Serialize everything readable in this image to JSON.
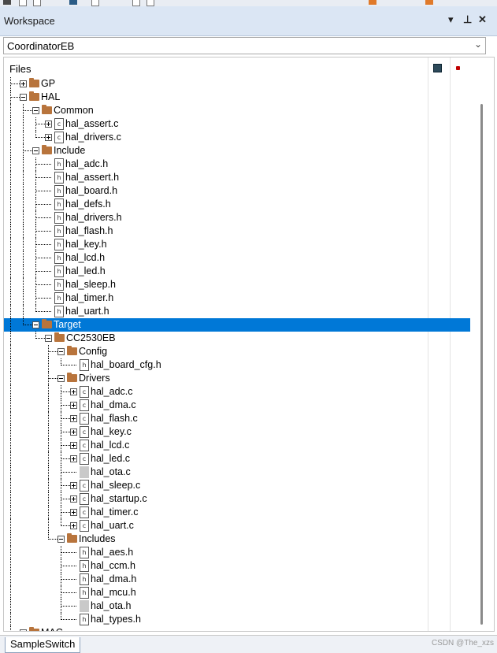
{
  "window": {
    "title": "Workspace",
    "buttons": [
      {
        "name": "dropdown-menu-button",
        "glyph": "▾"
      },
      {
        "name": "pin-button",
        "glyph": "⊥"
      },
      {
        "name": "close-button",
        "glyph": "✕"
      }
    ]
  },
  "configuration": {
    "selected": "CoordinatorEB"
  },
  "tree": {
    "header": "Files",
    "nodes": [
      {
        "label": "GP",
        "kind": "folder",
        "depth": 0,
        "exp": "plus",
        "last": false
      },
      {
        "label": "HAL",
        "kind": "folder",
        "depth": 0,
        "exp": "minus",
        "last": false
      },
      {
        "label": "Common",
        "kind": "folder",
        "depth": 1,
        "exp": "minus",
        "last": false
      },
      {
        "label": "hal_assert.c",
        "kind": "c",
        "depth": 2,
        "exp": "plus",
        "last": false
      },
      {
        "label": "hal_drivers.c",
        "kind": "c",
        "depth": 2,
        "exp": "plus",
        "last": true
      },
      {
        "label": "Include",
        "kind": "folder",
        "depth": 1,
        "exp": "minus",
        "last": false
      },
      {
        "label": "hal_adc.h",
        "kind": "h",
        "depth": 2,
        "exp": null,
        "last": false
      },
      {
        "label": "hal_assert.h",
        "kind": "h",
        "depth": 2,
        "exp": null,
        "last": false
      },
      {
        "label": "hal_board.h",
        "kind": "h",
        "depth": 2,
        "exp": null,
        "last": false
      },
      {
        "label": "hal_defs.h",
        "kind": "h",
        "depth": 2,
        "exp": null,
        "last": false
      },
      {
        "label": "hal_drivers.h",
        "kind": "h",
        "depth": 2,
        "exp": null,
        "last": false
      },
      {
        "label": "hal_flash.h",
        "kind": "h",
        "depth": 2,
        "exp": null,
        "last": false
      },
      {
        "label": "hal_key.h",
        "kind": "h",
        "depth": 2,
        "exp": null,
        "last": false
      },
      {
        "label": "hal_lcd.h",
        "kind": "h",
        "depth": 2,
        "exp": null,
        "last": false
      },
      {
        "label": "hal_led.h",
        "kind": "h",
        "depth": 2,
        "exp": null,
        "last": false
      },
      {
        "label": "hal_sleep.h",
        "kind": "h",
        "depth": 2,
        "exp": null,
        "last": false
      },
      {
        "label": "hal_timer.h",
        "kind": "h",
        "depth": 2,
        "exp": null,
        "last": false
      },
      {
        "label": "hal_uart.h",
        "kind": "h",
        "depth": 2,
        "exp": null,
        "last": true
      },
      {
        "label": "Target",
        "kind": "folder",
        "depth": 1,
        "exp": "minus",
        "last": true,
        "selected": true
      },
      {
        "label": "CC2530EB",
        "kind": "folder",
        "depth": 2,
        "exp": "minus",
        "last": true
      },
      {
        "label": "Config",
        "kind": "folder",
        "depth": 3,
        "exp": "minus",
        "last": false
      },
      {
        "label": "hal_board_cfg.h",
        "kind": "h",
        "depth": 4,
        "exp": null,
        "last": true
      },
      {
        "label": "Drivers",
        "kind": "folder",
        "depth": 3,
        "exp": "minus",
        "last": false
      },
      {
        "label": "hal_adc.c",
        "kind": "c",
        "depth": 4,
        "exp": "plus",
        "last": false
      },
      {
        "label": "hal_dma.c",
        "kind": "c",
        "depth": 4,
        "exp": "plus",
        "last": false
      },
      {
        "label": "hal_flash.c",
        "kind": "c",
        "depth": 4,
        "exp": "plus",
        "last": false
      },
      {
        "label": "hal_key.c",
        "kind": "c",
        "depth": 4,
        "exp": "plus",
        "last": false
      },
      {
        "label": "hal_lcd.c",
        "kind": "c",
        "depth": 4,
        "exp": "plus",
        "last": false
      },
      {
        "label": "hal_led.c",
        "kind": "c",
        "depth": 4,
        "exp": "plus",
        "last": false
      },
      {
        "label": "hal_ota.c",
        "kind": "gray",
        "depth": 4,
        "exp": null,
        "last": false
      },
      {
        "label": "hal_sleep.c",
        "kind": "c",
        "depth": 4,
        "exp": "plus",
        "last": false
      },
      {
        "label": "hal_startup.c",
        "kind": "c",
        "depth": 4,
        "exp": "plus",
        "last": false
      },
      {
        "label": "hal_timer.c",
        "kind": "c",
        "depth": 4,
        "exp": "plus",
        "last": false
      },
      {
        "label": "hal_uart.c",
        "kind": "c",
        "depth": 4,
        "exp": "plus",
        "last": true
      },
      {
        "label": "Includes",
        "kind": "folder",
        "depth": 3,
        "exp": "minus",
        "last": true
      },
      {
        "label": "hal_aes.h",
        "kind": "h",
        "depth": 4,
        "exp": null,
        "last": false
      },
      {
        "label": "hal_ccm.h",
        "kind": "h",
        "depth": 4,
        "exp": null,
        "last": false
      },
      {
        "label": "hal_dma.h",
        "kind": "h",
        "depth": 4,
        "exp": null,
        "last": false
      },
      {
        "label": "hal_mcu.h",
        "kind": "h",
        "depth": 4,
        "exp": null,
        "last": false
      },
      {
        "label": "hal_ota.h",
        "kind": "gray",
        "depth": 4,
        "exp": null,
        "last": false
      },
      {
        "label": "hal_types.h",
        "kind": "h",
        "depth": 4,
        "exp": null,
        "last": true
      },
      {
        "label": "MAC",
        "kind": "folder",
        "depth": 0,
        "exp": "plus",
        "last": false
      }
    ]
  },
  "tabs": [
    {
      "label": "SampleSwitch"
    }
  ],
  "watermark": "CSDN @The_xzs",
  "colors": {
    "selection": "#0078d7",
    "folder": "#b8743c",
    "titlebar": "#dbe6f4"
  }
}
